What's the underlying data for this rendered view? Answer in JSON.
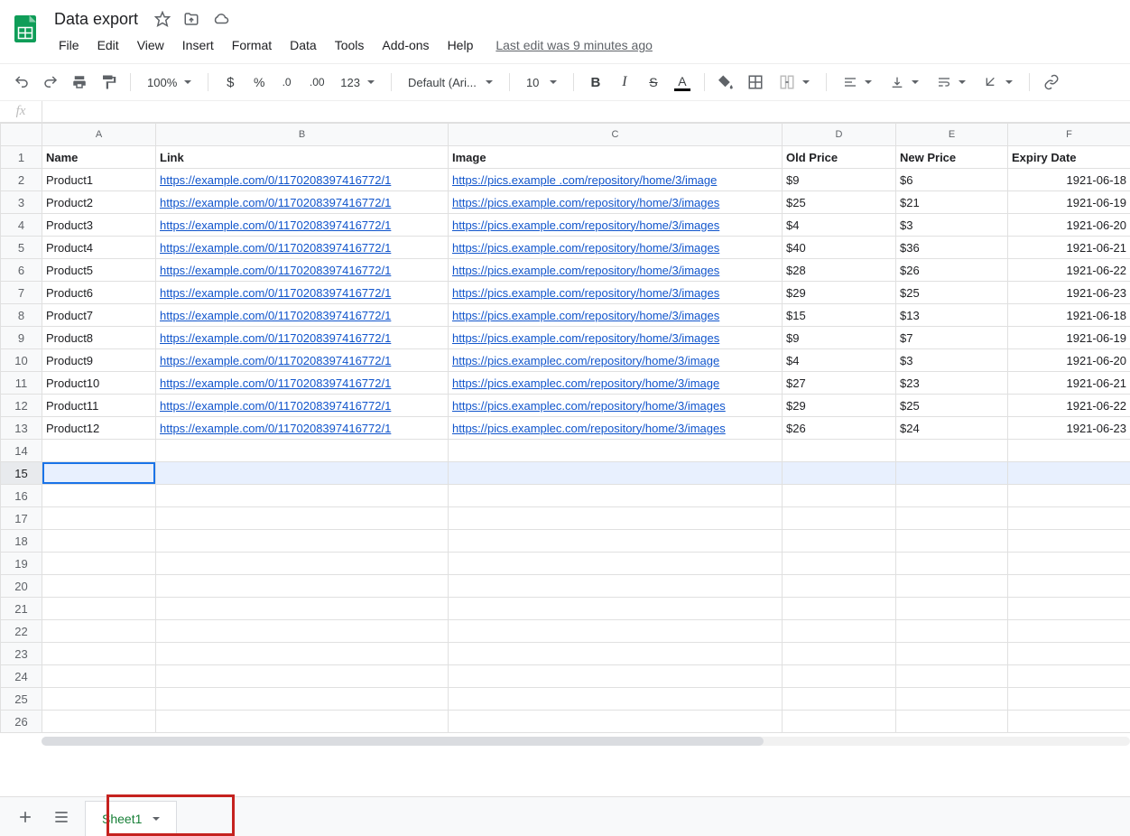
{
  "doc": {
    "title": "Data export",
    "last_edit": "Last edit was 9 minutes ago"
  },
  "menu": [
    "File",
    "Edit",
    "View",
    "Insert",
    "Format",
    "Data",
    "Tools",
    "Add-ons",
    "Help"
  ],
  "toolbar": {
    "zoom": "100%",
    "format_more": "123",
    "font": "Default (Ari...",
    "font_size": "10"
  },
  "sheet": {
    "active_tab": "Sheet1",
    "columns": [
      "A",
      "B",
      "C",
      "D",
      "E",
      "F"
    ],
    "headers": [
      "Name",
      "Link",
      "Image",
      "Old Price",
      "New Price",
      "Expiry Date"
    ],
    "link_text": "https://example.com/0/1170208397416772/1",
    "img_text_a": "https://pics.example .com/repository/home/3/image",
    "img_text_b": "https://pics.example.com/repository/home/3/images",
    "img_text_c": "https://pics.examplec.com/repository/home/3/image",
    "img_text_d": "https://pics.examplec.com/repository/home/3/images",
    "rows": [
      {
        "name": "Product1",
        "img": "a",
        "old": "$9",
        "new": "$6",
        "exp": "1921-06-18"
      },
      {
        "name": "Product2",
        "img": "b",
        "old": "$25",
        "new": "$21",
        "exp": "1921-06-19"
      },
      {
        "name": "Product3",
        "img": "b",
        "old": "$4",
        "new": "$3",
        "exp": "1921-06-20"
      },
      {
        "name": "Product4",
        "img": "b",
        "old": "$40",
        "new": "$36",
        "exp": "1921-06-21"
      },
      {
        "name": "Product5",
        "img": "b",
        "old": "$28",
        "new": "$26",
        "exp": "1921-06-22"
      },
      {
        "name": "Product6",
        "img": "b",
        "old": "$29",
        "new": "$25",
        "exp": "1921-06-23"
      },
      {
        "name": "Product7",
        "img": "b",
        "old": "$15",
        "new": "$13",
        "exp": "1921-06-18"
      },
      {
        "name": "Product8",
        "img": "b",
        "old": "$9",
        "new": "$7",
        "exp": "1921-06-19"
      },
      {
        "name": "Product9",
        "img": "c",
        "old": "$4",
        "new": "$3",
        "exp": "1921-06-20"
      },
      {
        "name": "Product10",
        "img": "c",
        "old": "$27",
        "new": "$23",
        "exp": "1921-06-21"
      },
      {
        "name": "Product11",
        "img": "d",
        "old": "$29",
        "new": "$25",
        "exp": "1921-06-22"
      },
      {
        "name": "Product12",
        "img": "d",
        "old": "$26",
        "new": "$24",
        "exp": "1921-06-23"
      }
    ],
    "total_rows_shown": 26,
    "selected_row": 15
  }
}
